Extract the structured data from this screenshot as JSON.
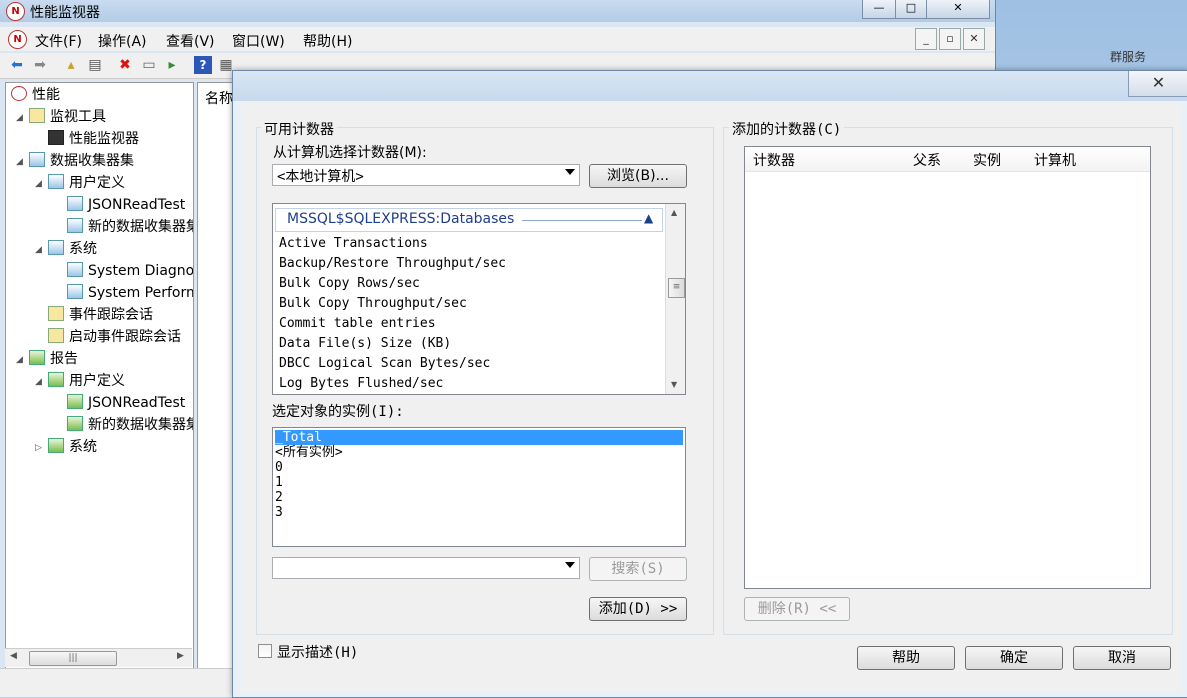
{
  "background": {
    "right_text": "群服务"
  },
  "main_window": {
    "title": "性能监视器",
    "app_icon": "perfmon-icon",
    "window_buttons": {
      "minimize": "—",
      "maximize": "□",
      "close": "✕"
    },
    "mdi_buttons": {
      "minimize": "_",
      "restore": "▫",
      "close": "✕"
    },
    "menu": [
      "文件(F)",
      "操作(A)",
      "查看(V)",
      "窗口(W)",
      "帮助(H)"
    ],
    "toolbar_icons": [
      "back-arrow-icon",
      "forward-arrow-icon",
      "up-folder-icon",
      "show-hide-tree-icon",
      "delete-icon",
      "properties-icon",
      "export-icon",
      "help-icon",
      "details-icon"
    ],
    "middle_header": "名称"
  },
  "tree": {
    "root": "性能",
    "monitoring_tools": "监视工具",
    "performance_monitor": "性能监视器",
    "data_collector_sets": "数据收集器集",
    "user_defined": "用户定义",
    "json_read_test": "JSONReadTest",
    "new_collector_set": "新的数据收集器集",
    "system": "系统",
    "system_diagnostics": "System Diagnostics",
    "system_performance": "System Performance",
    "event_trace_sessions": "事件跟踪会话",
    "startup_event_trace_sessions": "启动事件跟踪会话",
    "reports": "报告",
    "reports_user_defined": "用户定义",
    "reports_json_read_test": "JSONReadTest",
    "reports_new_collector_set": "新的数据收集器集",
    "reports_system": "系统",
    "scroll_thumb_grip": "|||"
  },
  "dialog": {
    "close_glyph": "✕",
    "available_group_label": "可用计数器",
    "select_from_computer_label": "从计算机选择计数器(M):",
    "computer_value": "<本地计算机>",
    "browse_button": "浏览(B)...",
    "counter_category": "MSSQL$SQLEXPRESS:Databases",
    "counter_category_collapse": "▲",
    "counters": [
      "Active Transactions",
      "Backup/Restore Throughput/sec",
      "Bulk Copy Rows/sec",
      "Bulk Copy Throughput/sec",
      "Commit table entries",
      "Data File(s) Size (KB)",
      "DBCC Logical Scan Bytes/sec",
      "Log Bytes Flushed/sec"
    ],
    "instances_label": "选定对象的实例(I):",
    "instances": [
      "_Total",
      "<所有实例>",
      "0",
      "1",
      "2",
      "3"
    ],
    "selected_instance_index": 0,
    "search_value": "",
    "search_button": "搜索(S)",
    "add_button": "添加(D) >>",
    "added_group_label": "添加的计数器(C)",
    "added_columns": [
      "计数器",
      "父系",
      "实例",
      "计算机"
    ],
    "remove_button": "删除(R) <<",
    "show_description_label": "显示描述(H)",
    "show_description_checked": false,
    "help_button": "帮助",
    "ok_button": "确定",
    "cancel_button": "取消"
  }
}
